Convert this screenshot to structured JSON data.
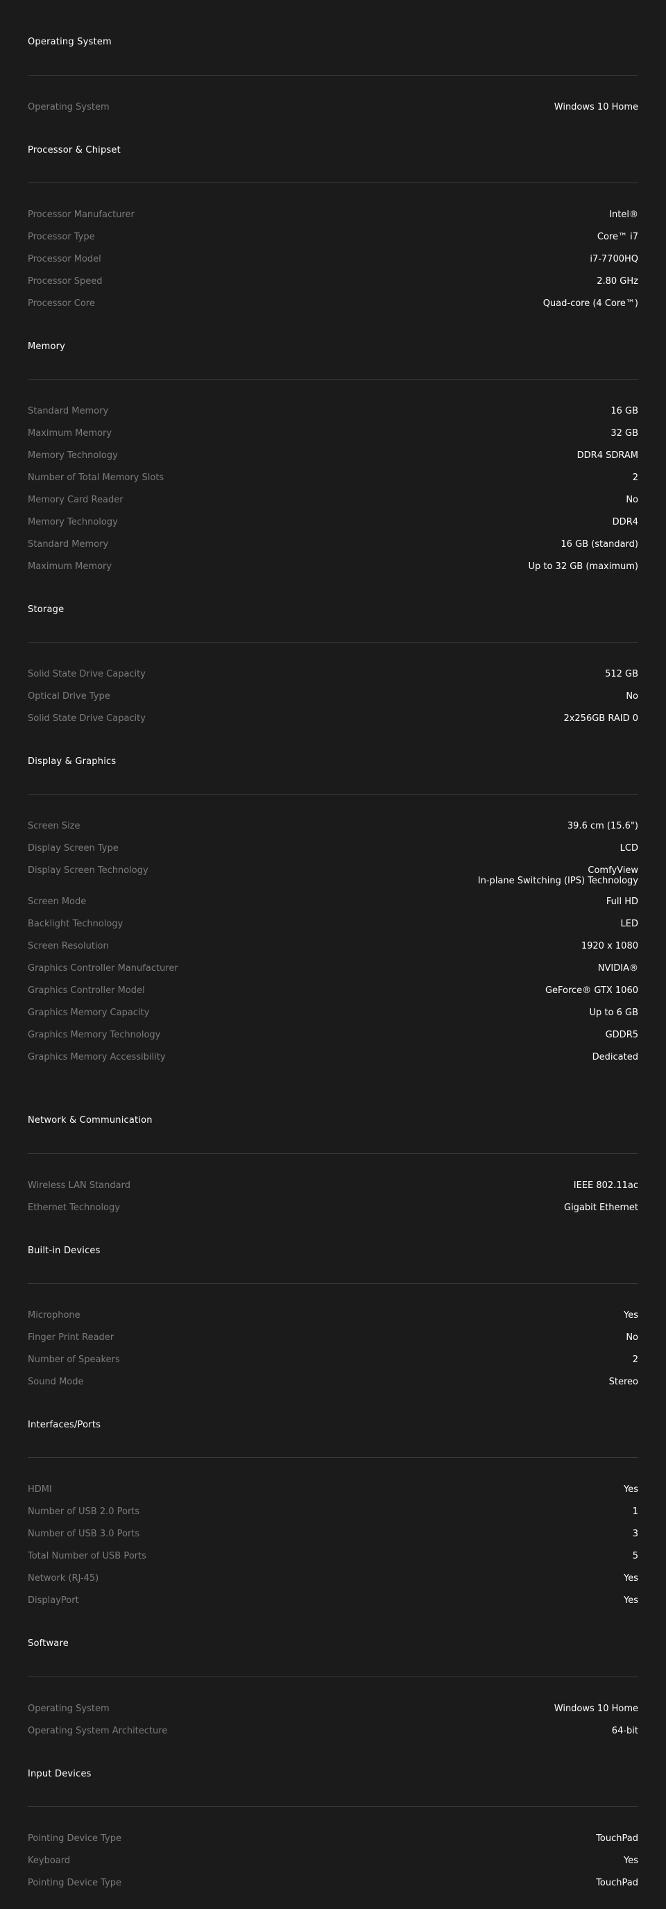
{
  "sections": [
    {
      "title": "Operating System",
      "rows": [
        {
          "label": "Operating System",
          "value": "Windows 10 Home"
        }
      ]
    },
    {
      "title": "Processor & Chipset",
      "rows": [
        {
          "label": "Processor Manufacturer",
          "value": "Intel®"
        },
        {
          "label": "Processor Type",
          "value": "Core™ i7"
        },
        {
          "label": "Processor Model",
          "value": "i7-7700HQ"
        },
        {
          "label": "Processor Speed",
          "value": "2.80 GHz"
        },
        {
          "label": "Processor Core",
          "value": "Quad-core (4 Core™)"
        }
      ]
    },
    {
      "title": "Memory",
      "rows": [
        {
          "label": "Standard Memory",
          "value": "16 GB"
        },
        {
          "label": "Maximum Memory",
          "value": "32 GB"
        },
        {
          "label": "Memory Technology",
          "value": "DDR4 SDRAM"
        },
        {
          "label": "Number of Total Memory Slots",
          "value": "2"
        },
        {
          "label": "Memory Card Reader",
          "value": "No"
        },
        {
          "label": "Memory Technology",
          "value": "DDR4"
        },
        {
          "label": "Standard Memory",
          "value": "16 GB (standard)"
        },
        {
          "label": "Maximum Memory",
          "value": "Up to 32 GB (maximum)"
        }
      ]
    },
    {
      "title": "Storage",
      "rows": [
        {
          "label": "Solid State Drive Capacity",
          "value": "512 GB"
        },
        {
          "label": "Optical Drive Type",
          "value": "No"
        },
        {
          "label": "Solid State Drive Capacity",
          "value": "2x256GB RAID 0"
        }
      ]
    },
    {
      "title": "Display & Graphics",
      "rows": [
        {
          "label": "Screen Size",
          "value": "39.6 cm (15.6\")"
        },
        {
          "label": "Display Screen Type",
          "value": "LCD"
        },
        {
          "label": "Display Screen Technology",
          "value": "ComfyView",
          "value2": "In-plane Switching (IPS) Technology"
        },
        {
          "label": "Screen Mode",
          "value": "Full HD"
        },
        {
          "label": "Backlight Technology",
          "value": "LED"
        },
        {
          "label": "Screen Resolution",
          "value": "1920 x 1080"
        },
        {
          "label": "Graphics Controller Manufacturer",
          "value": "NVIDIA®"
        },
        {
          "label": "Graphics Controller Model",
          "value": "GeForce® GTX 1060"
        },
        {
          "label": "Graphics Memory Capacity",
          "value": "Up to 6 GB"
        },
        {
          "label": "Graphics Memory Technology",
          "value": "GDDR5"
        },
        {
          "label": "Graphics Memory Accessibility",
          "value": "Dedicated"
        }
      ]
    },
    {
      "title": "Network & Communication",
      "rows": [
        {
          "label": "Wireless LAN Standard",
          "value": "IEEE 802.11ac"
        },
        {
          "label": "Ethernet Technology",
          "value": "Gigabit Ethernet"
        }
      ]
    },
    {
      "title": "Built-in Devices",
      "rows": [
        {
          "label": "Microphone",
          "value": "Yes"
        },
        {
          "label": "Finger Print Reader",
          "value": "No"
        },
        {
          "label": "Number of Speakers",
          "value": "2"
        },
        {
          "label": "Sound Mode",
          "value": "Stereo"
        }
      ]
    },
    {
      "title": "Interfaces/Ports",
      "rows": [
        {
          "label": "HDMI",
          "value": "Yes"
        },
        {
          "label": "Number of USB 2.0 Ports",
          "value": "1"
        },
        {
          "label": "Number of USB 3.0 Ports",
          "value": "3"
        },
        {
          "label": "Total Number of USB Ports",
          "value": "5"
        },
        {
          "label": "Network (RJ-45)",
          "value": "Yes"
        },
        {
          "label": "DisplayPort",
          "value": "Yes"
        }
      ]
    },
    {
      "title": "Software",
      "rows": [
        {
          "label": "Operating System",
          "value": "Windows 10 Home"
        },
        {
          "label": "Operating System Architecture",
          "value": "64-bit"
        }
      ]
    },
    {
      "title": "Input Devices",
      "rows": [
        {
          "label": "Pointing Device Type",
          "value": "TouchPad"
        },
        {
          "label": "Keyboard",
          "value": "Yes"
        },
        {
          "label": "Pointing Device Type",
          "value": "TouchPad"
        }
      ]
    }
  ]
}
